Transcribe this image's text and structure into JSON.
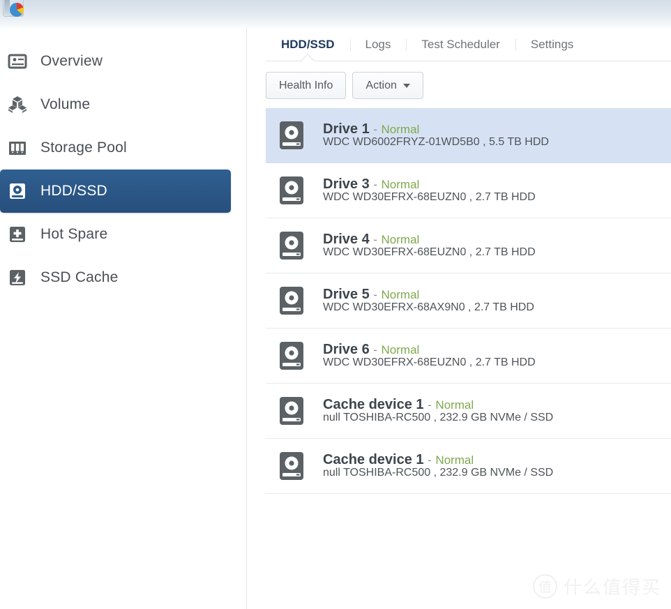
{
  "window": {
    "app_icon": "storage-manager-icon"
  },
  "sidebar": {
    "items": [
      {
        "label": "Overview",
        "icon": "overview-icon",
        "active": false
      },
      {
        "label": "Volume",
        "icon": "volume-icon",
        "active": false
      },
      {
        "label": "Storage Pool",
        "icon": "storage-pool-icon",
        "active": false
      },
      {
        "label": "HDD/SSD",
        "icon": "hdd-ssd-icon",
        "active": true
      },
      {
        "label": "Hot Spare",
        "icon": "hot-spare-icon",
        "active": false
      },
      {
        "label": "SSD Cache",
        "icon": "ssd-cache-icon",
        "active": false
      }
    ]
  },
  "content": {
    "tabs": [
      {
        "label": "HDD/SSD",
        "active": true
      },
      {
        "label": "Logs",
        "active": false
      },
      {
        "label": "Test Scheduler",
        "active": false
      },
      {
        "label": "Settings",
        "active": false
      }
    ],
    "toolbar": {
      "health_info_label": "Health Info",
      "action_label": "Action",
      "action_caret_icon": "caret-down-icon"
    },
    "drives": [
      {
        "name": "Drive 1",
        "separator": "-",
        "status": "Normal",
        "model": "WDC WD6002FRYZ-01WD5B0 , 5.5 TB HDD",
        "icon": "drive-icon",
        "selected": true
      },
      {
        "name": "Drive 3",
        "separator": "-",
        "status": "Normal",
        "model": "WDC WD30EFRX-68EUZN0 , 2.7 TB HDD",
        "icon": "drive-icon",
        "selected": false
      },
      {
        "name": "Drive 4",
        "separator": "-",
        "status": "Normal",
        "model": "WDC WD30EFRX-68EUZN0 , 2.7 TB HDD",
        "icon": "drive-icon",
        "selected": false
      },
      {
        "name": "Drive 5",
        "separator": "-",
        "status": "Normal",
        "model": "WDC WD30EFRX-68AX9N0 , 2.7 TB HDD",
        "icon": "drive-icon",
        "selected": false
      },
      {
        "name": "Drive 6",
        "separator": "-",
        "status": "Normal",
        "model": "WDC WD30EFRX-68EUZN0 , 2.7 TB HDD",
        "icon": "drive-icon",
        "selected": false
      },
      {
        "name": "Cache device 1",
        "separator": "-",
        "status": "Normal",
        "model": "null TOSHIBA-RC500 , 232.9 GB NVMe / SSD",
        "icon": "drive-icon",
        "selected": false
      },
      {
        "name": "Cache device 1",
        "separator": "-",
        "status": "Normal",
        "model": "null TOSHIBA-RC500 , 232.9 GB NVMe / SSD",
        "icon": "drive-icon",
        "selected": false
      }
    ]
  },
  "watermark": {
    "logo_text": "值",
    "text": "什么值得买"
  },
  "colors": {
    "sidebar_active_bg": "#2b5b8c",
    "row_selected_bg": "#d6e2f3",
    "status_normal": "#7fa84c",
    "tab_active_text": "#1f3a5f",
    "icon_gray": "#5b6165"
  }
}
